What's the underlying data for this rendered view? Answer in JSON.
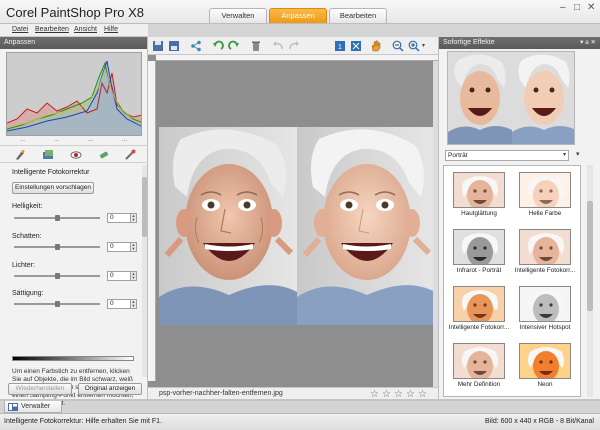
{
  "app": {
    "title": "Corel PaintShop Pro X8",
    "workspace_tabs": [
      "Verwalten",
      "Anpassen",
      "Bearbeiten"
    ],
    "active_tab": "Anpassen"
  },
  "menu": [
    "Datei",
    "Bearbeiten",
    "Ansicht",
    "Hilfe"
  ],
  "left_panel": {
    "header": "Anpassen",
    "histogram_dots": [
      "...",
      "...",
      "...",
      "..."
    ],
    "settings_title": "Intelligente Fotokorrektur",
    "suggest_button": "Einstellungen vorschlagen",
    "sliders": [
      {
        "label": "Helligkeit:",
        "value": "0",
        "position": 0.5
      },
      {
        "label": "Schatten:",
        "value": "0",
        "position": 0.5
      },
      {
        "label": "Lichter:",
        "value": "0",
        "position": 0.5
      },
      {
        "label": "Sättigung:",
        "value": "0",
        "position": 0.5
      }
    ],
    "help_text": "Um einen Farbstich zu entfernen, klicken Sie auf Objekte, die im Bild schwarz, weiß oder grau erscheinen sollten. Wenn Sie einen Sampling-Punkt entfernen möchten, klicken Sie darauf.",
    "reset_button": "Wiederherstellen",
    "original_button": "Original anzeigen"
  },
  "canvas": {
    "filename": "psp-vorher-nachher-falten-entfernen.jpg",
    "stars": [
      "☆",
      "☆",
      "☆",
      "☆",
      "☆"
    ]
  },
  "right_panel": {
    "header": "Sofortige Effekte",
    "header_controls": "▾ a ✕",
    "preset": "Porträt",
    "effects": [
      {
        "label": "Hautglättung",
        "style": "warm"
      },
      {
        "label": "Helle Farbe",
        "style": "bright"
      },
      {
        "label": "Infrarot - Porträt",
        "style": "bw"
      },
      {
        "label": "Intelligente Fotokorr...",
        "style": "warm"
      },
      {
        "label": "Intelligente Fotokorr...",
        "style": "orange"
      },
      {
        "label": "Intensiver Hotspot",
        "style": "bw-bright"
      },
      {
        "label": "Mehr Definition",
        "style": "warm"
      },
      {
        "label": "Neon",
        "style": "neon"
      }
    ]
  },
  "bottom_tab": "Verwalter",
  "status": {
    "left": "Intelligente Fotokorrektur: Hilfe erhalten Sie mit F1.",
    "right": "Bild:  600 x 440 x RGB - 8 Bit/Kanal"
  },
  "colors": {
    "accent": "#f0a020",
    "panel_header": "#5e5e5e",
    "canvas_bg": "#8e8e8e"
  }
}
